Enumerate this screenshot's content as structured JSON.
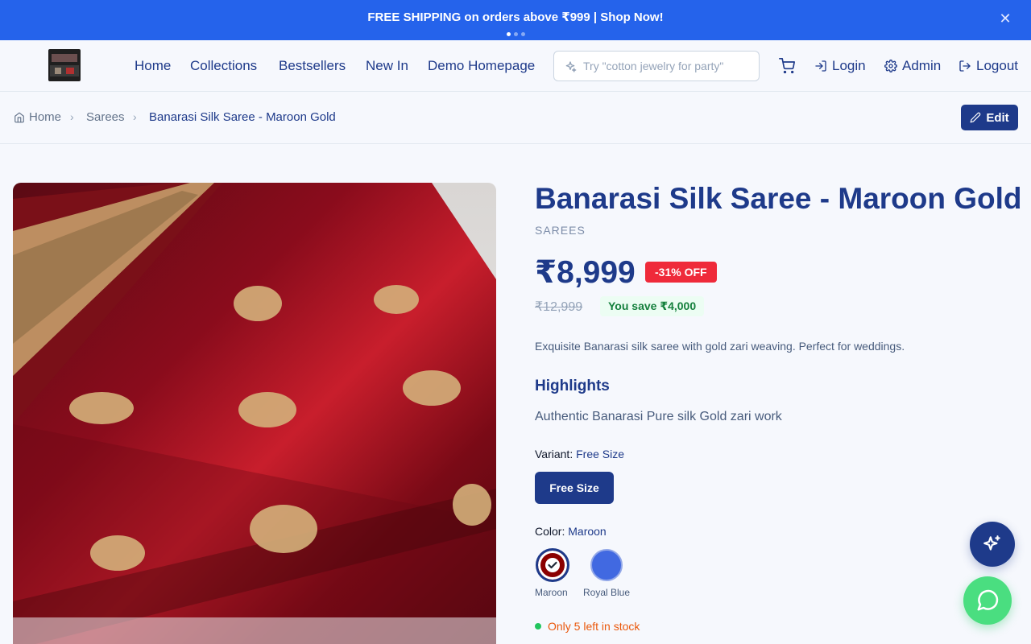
{
  "promo": {
    "text": "FREE SHIPPING on orders above ₹999 | Shop Now!",
    "close_icon": "close-icon",
    "slide_count": 3,
    "active_slide": 1
  },
  "nav": {
    "links": [
      "Home",
      "Collections",
      "Bestsellers",
      "New In",
      "Demo Homepage"
    ],
    "search_placeholder": "Try \"cotton jewelry for party\"",
    "login": "Login",
    "admin": "Admin",
    "logout": "Logout"
  },
  "breadcrumb": {
    "items": [
      "Home",
      "Sarees",
      "Banarasi Silk Saree - Maroon Gold"
    ],
    "edit_label": "Edit"
  },
  "product": {
    "title": "Banarasi Silk Saree - Maroon Gold",
    "category": "SAREES",
    "price": "₹8,999",
    "discount": "-31% OFF",
    "mrp": "₹12,999",
    "savings": "You save ₹4,000",
    "description": "Exquisite Banarasi silk saree with gold zari weaving. Perfect for weddings.",
    "highlights_heading": "Highlights",
    "highlights": "Authentic Banarasi Pure silk Gold zari work",
    "variant_label": "Variant:",
    "variant_selected": "Free Size",
    "variants": [
      "Free Size"
    ],
    "color_label": "Color:",
    "color_selected": "Maroon",
    "colors": [
      {
        "name": "Maroon",
        "hex": "#8b0000"
      },
      {
        "name": "Royal Blue",
        "hex": "#4169e1"
      }
    ],
    "stock": "Only 5 left in stock"
  },
  "colors": {
    "primary": "#1e3a8a",
    "promo_bg": "#2563eb",
    "discount_red": "#ef2a3a",
    "savings_green": "#15803d",
    "stock_orange": "#ea580c",
    "chat_green": "#4ade80"
  }
}
